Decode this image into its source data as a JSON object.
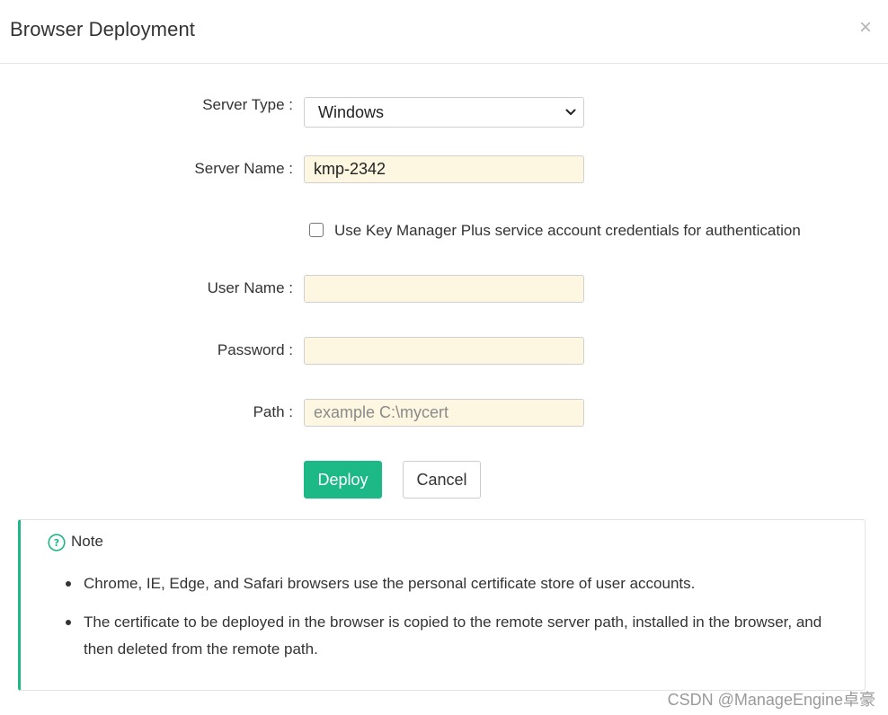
{
  "dialog": {
    "title": "Browser Deployment",
    "close_glyph": "×"
  },
  "form": {
    "server_type": {
      "label": "Server Type :",
      "selected": "Windows"
    },
    "server_name": {
      "label": "Server Name :",
      "value": "kmp-2342"
    },
    "use_service_account": {
      "label": "Use Key Manager Plus service account credentials for authentication",
      "checked": false
    },
    "user_name": {
      "label": "User Name :",
      "value": ""
    },
    "password": {
      "label": "Password :",
      "value": ""
    },
    "path": {
      "label": "Path :",
      "placeholder": "example C:\\mycert"
    }
  },
  "actions": {
    "deploy_label": "Deploy",
    "cancel_label": "Cancel"
  },
  "note": {
    "title": "Note",
    "icon": "question-circle-icon",
    "items": [
      "Chrome, IE, Edge, and Safari browsers use the personal certificate store of user accounts.",
      "The certificate to be deployed in the browser is copied to the remote server path, installed in the browser, and then deleted from the remote path."
    ]
  },
  "watermark": "CSDN @ManageEngine卓豪",
  "colors": {
    "accent": "#1cb987",
    "input_bg": "#fdf7e1",
    "border": "#cfcfcf"
  }
}
